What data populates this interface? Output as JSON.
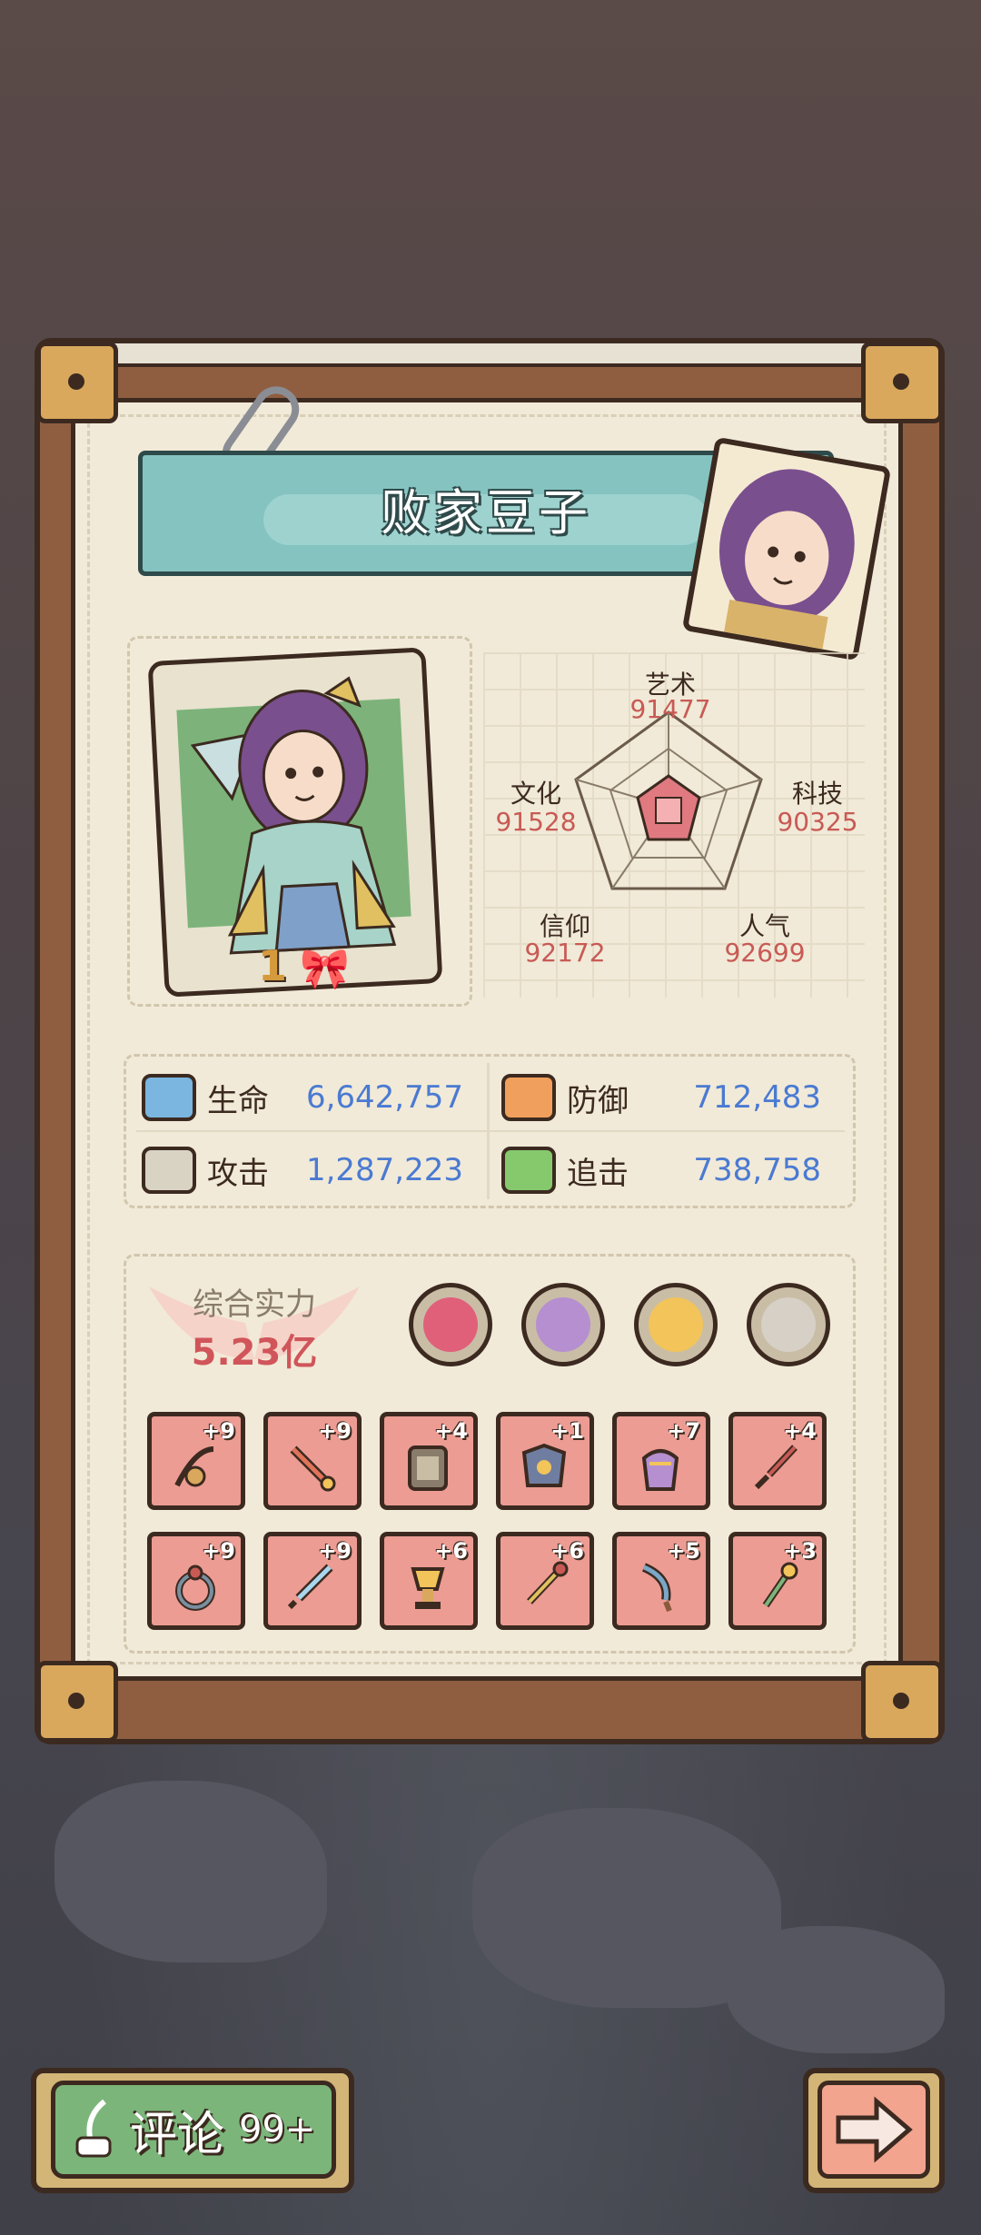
{
  "header": {
    "name": "败家豆子"
  },
  "character": {
    "level": "1"
  },
  "culture_stats": [
    {
      "label": "艺术",
      "value": "91477"
    },
    {
      "label": "科技",
      "value": "90325"
    },
    {
      "label": "人气",
      "value": "92699"
    },
    {
      "label": "信仰",
      "value": "92172"
    },
    {
      "label": "文化",
      "value": "91528"
    }
  ],
  "attributes": [
    {
      "label": "生命",
      "value": "6,642,757",
      "icon": "health-icon",
      "color": "#7ab6e0"
    },
    {
      "label": "防御",
      "value": "712,483",
      "icon": "defense-icon",
      "color": "#f0a05c"
    },
    {
      "label": "攻击",
      "value": "1,287,223",
      "icon": "attack-icon",
      "color": "#d9d3c4"
    },
    {
      "label": "追击",
      "value": "738,758",
      "icon": "pursuit-icon",
      "color": "#86c96d"
    }
  ],
  "power": {
    "label": "综合实力",
    "value": "5.23亿"
  },
  "badges": [
    {
      "icon": "dragon-cake-icon",
      "color": "#e0607a"
    },
    {
      "icon": "stamp-icon",
      "color": "#b58fd0"
    },
    {
      "icon": "globe-icon",
      "color": "#f2c45a"
    },
    {
      "icon": "tiger-mask-icon",
      "color": "#d7d0c6"
    }
  ],
  "equipment": [
    {
      "bonus": "+9",
      "icon": "bow-icon"
    },
    {
      "bonus": "+9",
      "icon": "sword-icon"
    },
    {
      "bonus": "+4",
      "icon": "book-icon"
    },
    {
      "bonus": "+1",
      "icon": "armor-icon"
    },
    {
      "bonus": "+7",
      "icon": "gauntlet-icon"
    },
    {
      "bonus": "+4",
      "icon": "dagger-icon"
    },
    {
      "bonus": "+9",
      "icon": "ring-icon"
    },
    {
      "bonus": "+9",
      "icon": "blade-icon"
    },
    {
      "bonus": "+6",
      "icon": "trophy-icon"
    },
    {
      "bonus": "+6",
      "icon": "scepter-icon"
    },
    {
      "bonus": "+5",
      "icon": "knife-icon"
    },
    {
      "bonus": "+3",
      "icon": "staff-icon"
    }
  ],
  "footer": {
    "comment_label": "评论",
    "comment_count": "99+"
  }
}
